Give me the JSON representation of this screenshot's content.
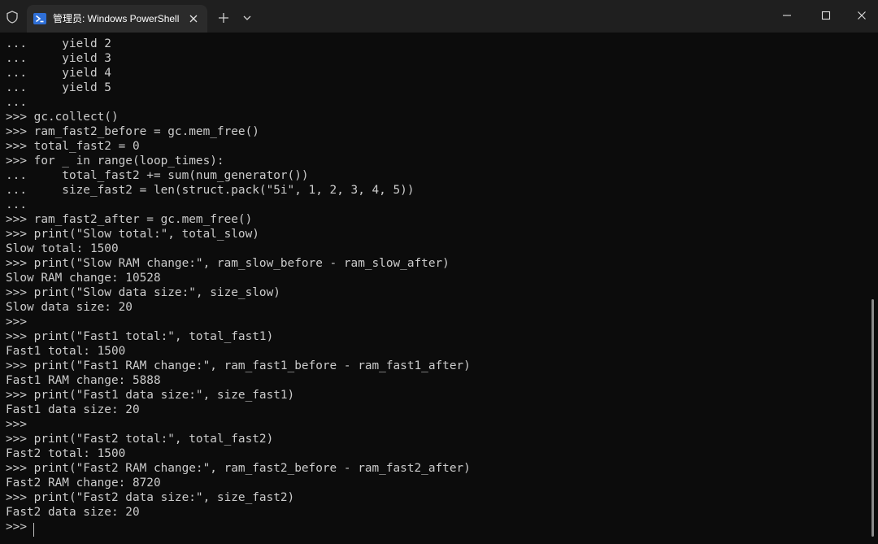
{
  "window": {
    "tab_title": "管理员: Windows PowerShell",
    "tab_icon": "powershell-icon",
    "security_icon": "shield-icon",
    "new_tab_icon": "plus-icon",
    "dropdown_icon": "chevron-down-icon",
    "controls": [
      "minimize-icon",
      "maximize-icon",
      "close-icon"
    ]
  },
  "colors": {
    "background": "#0c0c0c",
    "titlebar": "#1f1f1f",
    "active_tab": "#2b2b2b",
    "text": "#cccccc"
  },
  "terminal": {
    "lines": [
      "...     yield 2",
      "...     yield 3",
      "...     yield 4",
      "...     yield 5",
      "...",
      ">>> gc.collect()",
      ">>> ram_fast2_before = gc.mem_free()",
      ">>> total_fast2 = 0",
      ">>> for _ in range(loop_times):",
      "...     total_fast2 += sum(num_generator())",
      "...     size_fast2 = len(struct.pack(\"5i\", 1, 2, 3, 4, 5))",
      "...",
      ">>> ram_fast2_after = gc.mem_free()",
      ">>> print(\"Slow total:\", total_slow)",
      "Slow total: 1500",
      ">>> print(\"Slow RAM change:\", ram_slow_before - ram_slow_after)",
      "Slow RAM change: 10528",
      ">>> print(\"Slow data size:\", size_slow)",
      "Slow data size: 20",
      ">>>",
      ">>> print(\"Fast1 total:\", total_fast1)",
      "Fast1 total: 1500",
      ">>> print(\"Fast1 RAM change:\", ram_fast1_before - ram_fast1_after)",
      "Fast1 RAM change: 5888",
      ">>> print(\"Fast1 data size:\", size_fast1)",
      "Fast1 data size: 20",
      ">>>",
      ">>> print(\"Fast2 total:\", total_fast2)",
      "Fast2 total: 1500",
      ">>> print(\"Fast2 RAM change:\", ram_fast2_before - ram_fast2_after)",
      "Fast2 RAM change: 8720",
      ">>> print(\"Fast2 data size:\", size_fast2)",
      "Fast2 data size: 20",
      ">>>"
    ]
  }
}
